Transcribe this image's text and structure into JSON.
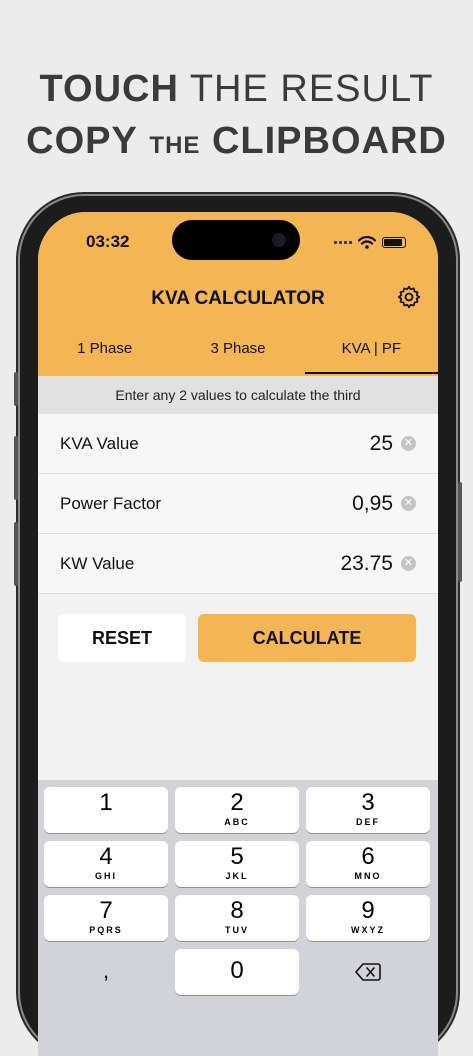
{
  "headline": {
    "line1_bold": "TOUCH",
    "line1_rest": "THE RESULT",
    "line2_bold1": "COPY",
    "line2_small": "THE",
    "line2_bold2": "CLIPBOARD"
  },
  "status_bar": {
    "time": "03:32"
  },
  "app": {
    "title": "KVA CALCULATOR"
  },
  "icons": {
    "settings": "gear-icon",
    "wifi": "wifi-icon",
    "battery": "battery-icon",
    "clear": "clear-circle-icon",
    "backspace": "backspace-icon"
  },
  "tabs": [
    {
      "label": "1 Phase",
      "active": false
    },
    {
      "label": "3 Phase",
      "active": false
    },
    {
      "label": "KVA | PF",
      "active": true
    }
  ],
  "hint": "Enter any 2 values to calculate the third",
  "fields": [
    {
      "label": "KVA Value",
      "value": "25"
    },
    {
      "label": "Power Factor",
      "value": "0,95"
    },
    {
      "label": "KW Value",
      "value": "23.75"
    }
  ],
  "buttons": {
    "reset": "RESET",
    "calculate": "CALCULATE"
  },
  "keyboard": {
    "keys": [
      {
        "num": "1",
        "letters": ""
      },
      {
        "num": "2",
        "letters": "ABC"
      },
      {
        "num": "3",
        "letters": "DEF"
      },
      {
        "num": "4",
        "letters": "GHI"
      },
      {
        "num": "5",
        "letters": "JKL"
      },
      {
        "num": "6",
        "letters": "MNO"
      },
      {
        "num": "7",
        "letters": "PQRS"
      },
      {
        "num": "8",
        "letters": "TUV"
      },
      {
        "num": "9",
        "letters": "WXYZ"
      }
    ],
    "decimal": ",",
    "zero": "0"
  },
  "colors": {
    "accent": "#f4b554",
    "background": "#ececec"
  }
}
